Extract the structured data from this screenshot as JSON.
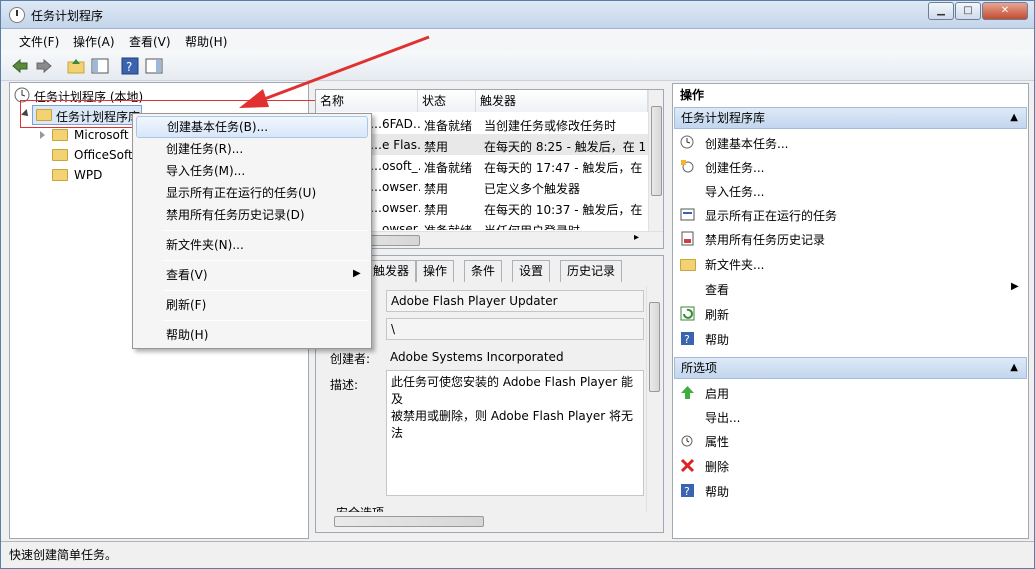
{
  "window": {
    "title": "任务计划程序",
    "min_label": "▁",
    "max_label": "□",
    "close_label": "✕"
  },
  "menubar": [
    "文件(F)",
    "操作(A)",
    "查看(V)",
    "帮助(H)"
  ],
  "tree": {
    "root": "任务计划程序 (本地)",
    "library": "任务计划程序库",
    "children": [
      "Microsoft",
      "OfficeSoft",
      "WPD"
    ]
  },
  "task_list": {
    "columns": [
      "名称",
      "状态",
      "触发器"
    ],
    "rows": [
      {
        "name": "…6FAD…",
        "status": "准备就绪",
        "trigger": "当创建任务或修改任务时"
      },
      {
        "name": "…e Flas…",
        "status": "禁用",
        "trigger": "在每天的 8:25 - 触发后，在 1"
      },
      {
        "name": "…osoft_…",
        "status": "准备就绪",
        "trigger": "在每天的 17:47 - 触发后，在"
      },
      {
        "name": "…owser…",
        "status": "禁用",
        "trigger": "已定义多个触发器"
      },
      {
        "name": "…owser…",
        "status": "禁用",
        "trigger": "在每天的 10:37 - 触发后，在"
      },
      {
        "name": "…owser…",
        "status": "准备就绪",
        "trigger": "当任何用户登录时"
      }
    ]
  },
  "detail_tabs": [
    "触发器",
    "操作",
    "条件",
    "设置",
    "历史记录"
  ],
  "detail": {
    "name_value": "Adobe Flash Player Updater",
    "location_value": "\\",
    "author_label": "创建者:",
    "author_value": "Adobe Systems Incorporated",
    "desc_label": "描述:",
    "desc_value_1": "此任务可使您安装的 Adobe Flash Player 能及",
    "desc_value_2": "被禁用或删除，则 Adobe Flash Player 将无法",
    "security_label": "安全选项"
  },
  "context_menu": {
    "items": [
      "创建基本任务(B)...",
      "创建任务(R)...",
      "导入任务(M)...",
      "显示所有正在运行的任务(U)",
      "禁用所有任务历史记录(D)",
      "新文件夹(N)...",
      "查看(V)",
      "刷新(F)",
      "帮助(H)"
    ]
  },
  "actions": {
    "header": "操作",
    "section1": "任务计划程序库",
    "section1_items": [
      "创建基本任务...",
      "创建任务...",
      "导入任务...",
      "显示所有正在运行的任务",
      "禁用所有任务历史记录",
      "新文件夹...",
      "查看",
      "刷新",
      "帮助"
    ],
    "section2": "所选项",
    "section2_items": [
      "启用",
      "导出...",
      "属性",
      "删除",
      "帮助"
    ]
  },
  "status": "快速创建简单任务。",
  "colors": {
    "accent": "#3399ff",
    "highlight_border": "#e03030",
    "arrow": "#e03030"
  }
}
